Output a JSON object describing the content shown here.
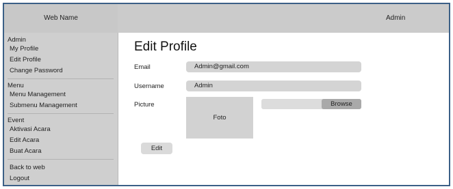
{
  "sidebar": {
    "brand": "Web Name",
    "sections": {
      "admin": {
        "heading": "Admin",
        "items": [
          "My Profile",
          "Edit Profile",
          "Change Password"
        ]
      },
      "menu": {
        "heading": "Menu",
        "items": [
          "Menu Management",
          "Submenu Management"
        ]
      },
      "event": {
        "heading": "Event",
        "items": [
          "Aktivasi Acara",
          "Edit Acara",
          "Buat Acara"
        ]
      },
      "footer": {
        "items": [
          "Back to web",
          "Logout"
        ]
      }
    }
  },
  "topbar": {
    "user": "Admin"
  },
  "main": {
    "title": "Edit Profile",
    "form": {
      "email_label": "Email",
      "email_value": "Admin@gmail.com",
      "username_label": "Username",
      "username_value": "Admin",
      "picture_label": "Picture",
      "picture_placeholder": "Foto",
      "browse_label": "Browse",
      "edit_label": "Edit"
    }
  }
}
